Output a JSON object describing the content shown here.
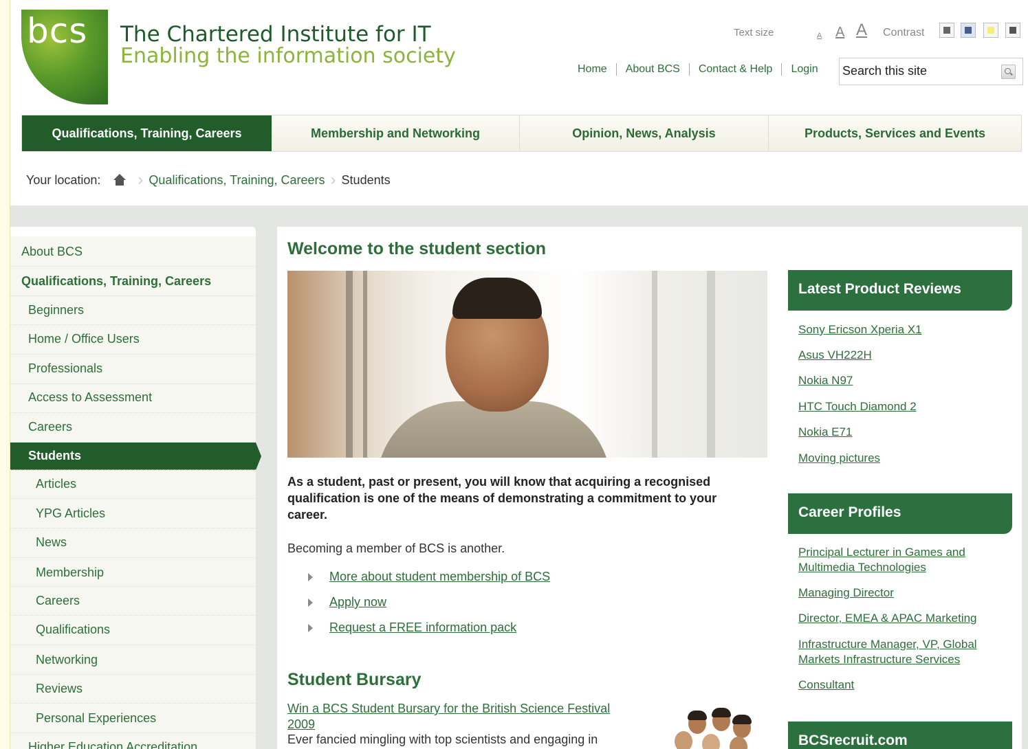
{
  "header": {
    "logo_text": "bcs",
    "title": "The Chartered Institute for IT",
    "tagline": "Enabling the information society",
    "text_size_label": "Text size",
    "text_size_options": [
      "A",
      "A",
      "A"
    ],
    "contrast_label": "Contrast",
    "top_links": [
      "Home",
      "About BCS",
      "Contact & Help",
      "Login"
    ],
    "search_placeholder": "Search this site"
  },
  "nav": {
    "tabs": [
      {
        "label": "Qualifications, Training, Careers",
        "active": true
      },
      {
        "label": "Membership and Networking",
        "active": false
      },
      {
        "label": "Opinion, News, Analysis",
        "active": false
      },
      {
        "label": "Products, Services and Events",
        "active": false
      }
    ]
  },
  "breadcrumb": {
    "label": "Your location:",
    "items": [
      "Qualifications, Training, Careers",
      "Students"
    ]
  },
  "sidebar": {
    "items": [
      {
        "label": "About BCS",
        "level": 0
      },
      {
        "label": "Qualifications, Training, Careers",
        "level": 0
      },
      {
        "label": "Beginners",
        "level": 1
      },
      {
        "label": "Home / Office Users",
        "level": 1
      },
      {
        "label": "Professionals",
        "level": 1
      },
      {
        "label": "Access to Assessment",
        "level": 1
      },
      {
        "label": "Careers",
        "level": 1
      },
      {
        "label": "Students",
        "level": 1
      },
      {
        "label": "Articles",
        "level": 2
      },
      {
        "label": "YPG Articles",
        "level": 2
      },
      {
        "label": "News",
        "level": 2
      },
      {
        "label": "Membership",
        "level": 2
      },
      {
        "label": "Careers",
        "level": 2
      },
      {
        "label": "Qualifications",
        "level": 2
      },
      {
        "label": "Networking",
        "level": 2
      },
      {
        "label": "Reviews",
        "level": 2
      },
      {
        "label": "Personal Experiences",
        "level": 2
      },
      {
        "label": "Higher Education Accreditation",
        "level": 1
      }
    ]
  },
  "main": {
    "heading": "Welcome to the student section",
    "intro": "As a student, past or present, you will know that acquiring a recognised qualification is one of the means of demonstrating a commitment to your career.",
    "para": "Becoming a member of BCS is another.",
    "bullets": [
      "More about student membership of BCS",
      "Apply now",
      "Request a FREE information pack"
    ],
    "bursary_heading": "Student Bursary",
    "bursary_link": "Win a BCS Student Bursary for the British Science Festival 2009",
    "bursary_text": "Ever fancied mingling with top scientists and engaging in"
  },
  "right": {
    "reviews": {
      "title": "Latest Product Reviews",
      "items": [
        "Sony Ericson Xperia X1",
        "Asus VH222H",
        "Nokia N97",
        "HTC Touch Diamond 2",
        "Nokia E71",
        "Moving pictures"
      ]
    },
    "careers": {
      "title": "Career Profiles",
      "items": [
        "Principal Lecturer in Games and Multimedia Technologies",
        "Managing Director",
        "Director, EMEA & APAC Marketing",
        "Infrastructure Manager, VP, Global Markets Infrastructure Services",
        "Consultant"
      ]
    },
    "recruit": {
      "title": "BCSrecruit.com"
    }
  },
  "colors": {
    "brand_dark": "#215c2a",
    "link_green": "#2e6e3a",
    "tagline_green": "#8cb43a",
    "panel_green": "#2d7040"
  }
}
